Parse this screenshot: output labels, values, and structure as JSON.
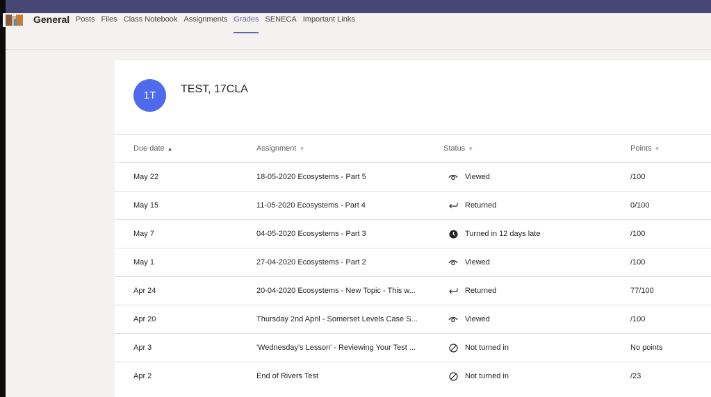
{
  "channel": {
    "name": "General",
    "tabs": [
      "Posts",
      "Files",
      "Class Notebook",
      "Assignments",
      "Grades",
      "SENECA",
      "Important Links"
    ],
    "active_tab": "Grades"
  },
  "class": {
    "avatar_initials": "1T",
    "avatar_color": "#4f6bed",
    "name": "TEST, 17CLA"
  },
  "table": {
    "headers": {
      "due_date": "Due date",
      "assignment": "Assignment",
      "status": "Status",
      "points": "Points"
    },
    "rows": [
      {
        "due": "May 22",
        "assignment": "18-05-2020 Ecosystems - Part 5",
        "status": "Viewed",
        "status_icon": "eye-icon",
        "points": "/100"
      },
      {
        "due": "May 15",
        "assignment": "11-05-2020 Ecosystems - Part 4",
        "status": "Returned",
        "status_icon": "return-arrow-icon",
        "points": "0/100"
      },
      {
        "due": "May 7",
        "assignment": "04-05-2020 Ecosystems - Part 3",
        "status": "Turned in 12 days late",
        "status_icon": "clock-icon",
        "points": "/100"
      },
      {
        "due": "May 1",
        "assignment": "27-04-2020 Ecosystems - Part 2",
        "status": "Viewed",
        "status_icon": "eye-icon",
        "points": "/100"
      },
      {
        "due": "Apr 24",
        "assignment": "20-04-2020 Ecosystems - New Topic - This w...",
        "status": "Returned",
        "status_icon": "return-arrow-icon",
        "points": "77/100"
      },
      {
        "due": "Apr 20",
        "assignment": "Thursday 2nd April - Somerset Levels Case S...",
        "status": "Viewed",
        "status_icon": "eye-icon",
        "points": "/100"
      },
      {
        "due": "Apr 3",
        "assignment": "'Wednesday's Lesson' - Reviewing Your Test ...",
        "status": "Not turned in",
        "status_icon": "not-turned-in-icon",
        "points": "No points"
      },
      {
        "due": "Apr 2",
        "assignment": "End of Rivers Test",
        "status": "Not turned in",
        "status_icon": "not-turned-in-icon",
        "points": "/23"
      }
    ]
  },
  "colors": {
    "accent": "#6264a7",
    "top_bar": "#464775",
    "background": "#f3f2f1"
  }
}
